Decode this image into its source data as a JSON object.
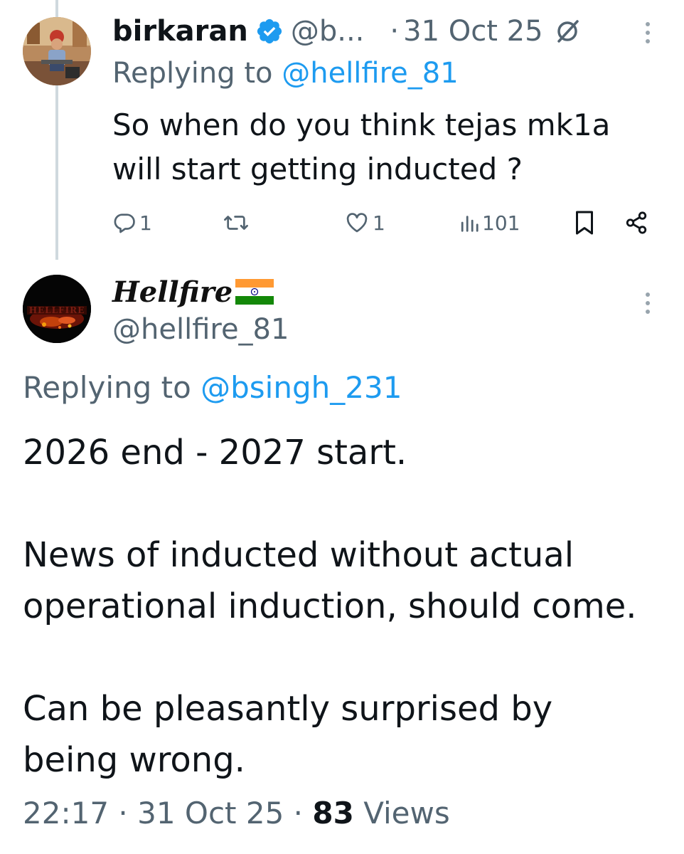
{
  "tweet1": {
    "display_name": "birkaran",
    "handle": "@b...",
    "separator": "·",
    "date": "31 Oct 25",
    "replying_prefix": "Replying to ",
    "replying_handle": "@hellfire_81",
    "text_lines": [
      "So when do you think tejas mk1a",
      "will start getting inducted ?"
    ],
    "replies_count": "1",
    "likes_count": "1",
    "views_count": "101",
    "icons": {
      "verified": "verified-badge-icon",
      "grok": "grok-icon",
      "more": "more-options-icon",
      "reply": "reply-icon",
      "retweet": "retweet-icon",
      "like": "like-icon",
      "views": "views-icon",
      "bookmark": "bookmark-icon",
      "share": "share-icon"
    }
  },
  "tweet2": {
    "display_name": "Hellfire",
    "flag": "🇮🇳",
    "handle": "@hellfire_81",
    "replying_prefix": "Replying to ",
    "replying_handle": "@bsingh_231",
    "paragraphs": [
      [
        "2026 end - 2027 start."
      ],
      [
        "News of inducted without actual",
        "operational induction, should come."
      ],
      [
        "Can be pleasantly surprised by",
        "being wrong."
      ]
    ],
    "time": "22:17",
    "dot": " · ",
    "date": "31 Oct 25",
    "views_number": "83",
    "views_label": " Views"
  },
  "colors": {
    "text": "#0f1419",
    "muted": "#536471",
    "link": "#1d9bf0",
    "verified": "#1d9bf0",
    "thread_line": "#cfd9de"
  }
}
